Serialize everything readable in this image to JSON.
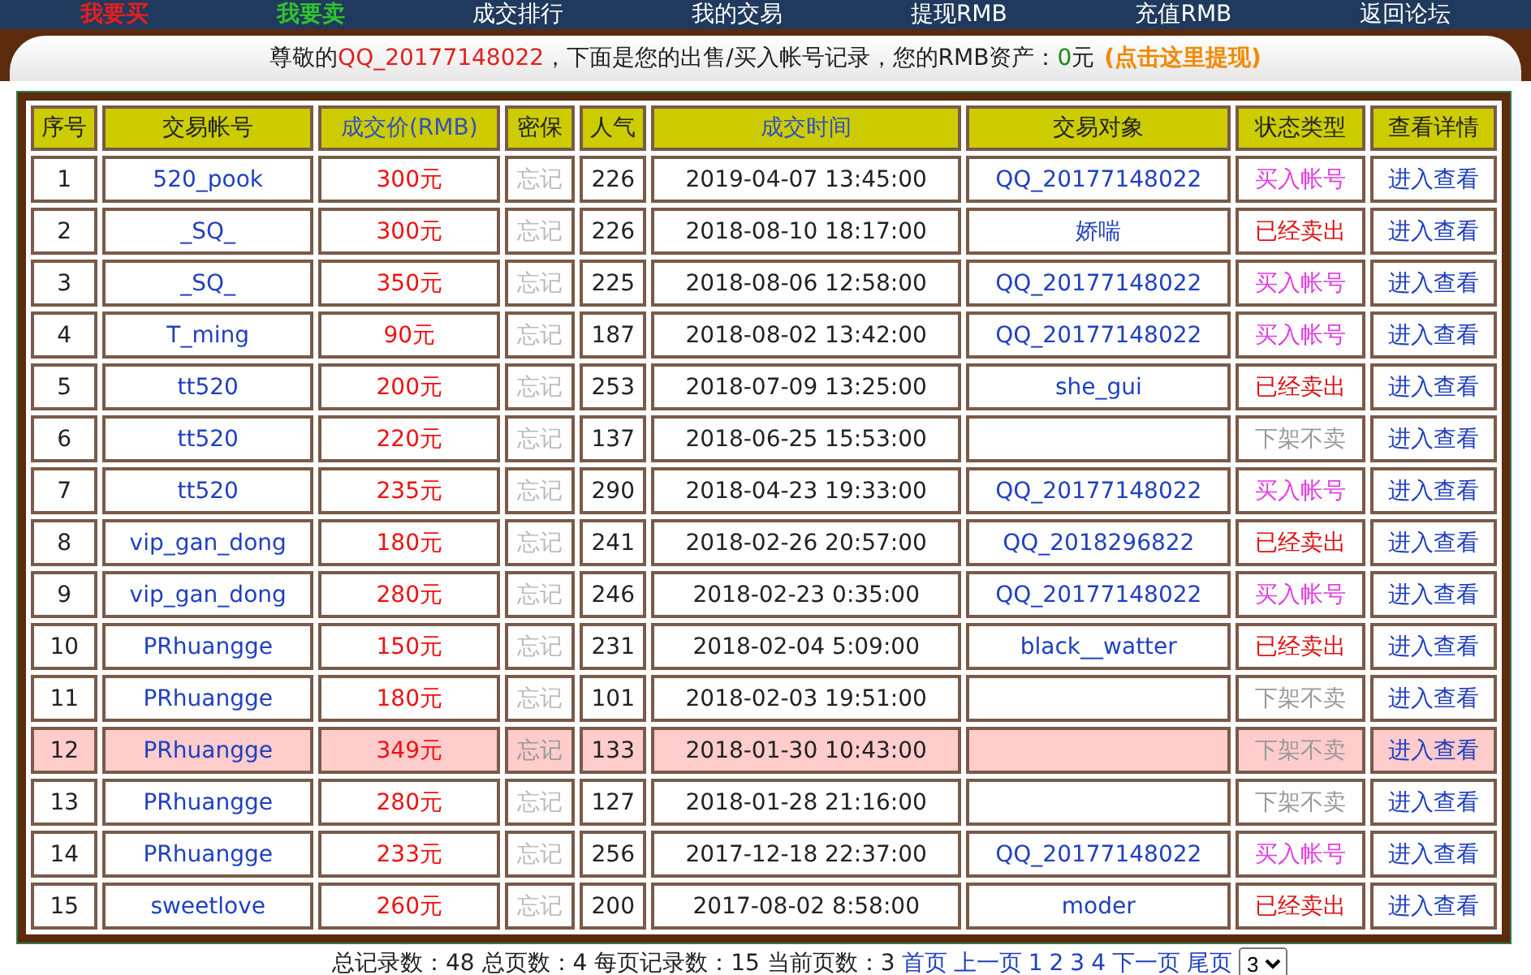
{
  "nav": [
    {
      "label": "我要买",
      "kind": "buy"
    },
    {
      "label": "我要卖",
      "kind": "sell"
    },
    {
      "label": "成交排行",
      "kind": "plain"
    },
    {
      "label": "我的交易",
      "kind": "plain"
    },
    {
      "label": "提现RMB",
      "kind": "plain"
    },
    {
      "label": "充值RMB",
      "kind": "plain"
    },
    {
      "label": "返回论坛",
      "kind": "plain"
    }
  ],
  "notice": {
    "prefix": "尊敬的",
    "user": "QQ_20177148022",
    "middle": "，下面是您的出售/买入帐号记录，您的RMB资产：",
    "amount": "0",
    "unit": "元",
    "link": "(点击这里提现)"
  },
  "table": {
    "columns": [
      "序号",
      "交易帐号",
      "成交价(RMB)",
      "密保",
      "人气",
      "成交时间",
      "交易对象",
      "状态类型",
      "查看详情"
    ],
    "rows": [
      {
        "no": "1",
        "account": "520_pook",
        "price": "300元",
        "security": "忘记",
        "popularity": "226",
        "time": "2019-04-07 13:45:00",
        "party": "QQ_20177148022",
        "status": "买入帐号",
        "kind": "buy",
        "action": "进入查看",
        "selected": false
      },
      {
        "no": "2",
        "account": "_SQ_",
        "price": "300元",
        "security": "忘记",
        "popularity": "226",
        "time": "2018-08-10 18:17:00",
        "party": "娇喘",
        "status": "已经卖出",
        "kind": "sold",
        "action": "进入查看",
        "selected": false
      },
      {
        "no": "3",
        "account": "_SQ_",
        "price": "350元",
        "security": "忘记",
        "popularity": "225",
        "time": "2018-08-06 12:58:00",
        "party": "QQ_20177148022",
        "status": "买入帐号",
        "kind": "buy",
        "action": "进入查看",
        "selected": false
      },
      {
        "no": "4",
        "account": "T_ming",
        "price": "90元",
        "security": "忘记",
        "popularity": "187",
        "time": "2018-08-02 13:42:00",
        "party": "QQ_20177148022",
        "status": "买入帐号",
        "kind": "buy",
        "action": "进入查看",
        "selected": false
      },
      {
        "no": "5",
        "account": "tt520",
        "price": "200元",
        "security": "忘记",
        "popularity": "253",
        "time": "2018-07-09 13:25:00",
        "party": "she_gui",
        "status": "已经卖出",
        "kind": "sold",
        "action": "进入查看",
        "selected": false
      },
      {
        "no": "6",
        "account": "tt520",
        "price": "220元",
        "security": "忘记",
        "popularity": "137",
        "time": "2018-06-25 15:53:00",
        "status": "下架不卖",
        "kind": "delisted",
        "action": "进入查看",
        "selected": false
      },
      {
        "no": "7",
        "account": "tt520",
        "price": "235元",
        "security": "忘记",
        "popularity": "290",
        "time": "2018-04-23 19:33:00",
        "party": "QQ_20177148022",
        "status": "买入帐号",
        "kind": "buy",
        "action": "进入查看",
        "selected": false
      },
      {
        "no": "8",
        "account": "vip_gan_dong",
        "price": "180元",
        "security": "忘记",
        "popularity": "241",
        "time": "2018-02-26 20:57:00",
        "party": "QQ_2018296822",
        "status": "已经卖出",
        "kind": "sold",
        "action": "进入查看",
        "selected": false
      },
      {
        "no": "9",
        "account": "vip_gan_dong",
        "price": "280元",
        "security": "忘记",
        "popularity": "246",
        "time": "2018-02-23 0:35:00",
        "party": "QQ_20177148022",
        "status": "买入帐号",
        "kind": "buy",
        "action": "进入查看",
        "selected": false
      },
      {
        "no": "10",
        "account": "PRhuangge",
        "price": "150元",
        "security": "忘记",
        "popularity": "231",
        "time": "2018-02-04 5:09:00",
        "party": "black__watter",
        "status": "已经卖出",
        "kind": "sold",
        "action": "进入查看",
        "selected": false
      },
      {
        "no": "11",
        "account": "PRhuangge",
        "price": "180元",
        "security": "忘记",
        "popularity": "101",
        "time": "2018-02-03 19:51:00",
        "status": "下架不卖",
        "kind": "delisted",
        "action": "进入查看",
        "selected": false
      },
      {
        "no": "12",
        "account": "PRhuangge",
        "price": "349元",
        "security": "忘记",
        "popularity": "133",
        "time": "2018-01-30 10:43:00",
        "status": "下架不卖",
        "kind": "delisted",
        "action": "进入查看",
        "selected": true
      },
      {
        "no": "13",
        "account": "PRhuangge",
        "price": "280元",
        "security": "忘记",
        "popularity": "127",
        "time": "2018-01-28 21:16:00",
        "status": "下架不卖",
        "kind": "delisted",
        "action": "进入查看",
        "selected": false
      },
      {
        "no": "14",
        "account": "PRhuangge",
        "price": "233元",
        "security": "忘记",
        "popularity": "256",
        "time": "2017-12-18 22:37:00",
        "party": "QQ_20177148022",
        "status": "买入帐号",
        "kind": "buy",
        "action": "进入查看",
        "selected": false
      },
      {
        "no": "15",
        "account": "sweetlove",
        "price": "260元",
        "security": "忘记",
        "popularity": "200",
        "time": "2017-08-02 8:58:00",
        "party": "moder",
        "status": "已经卖出",
        "kind": "sold",
        "action": "进入查看",
        "selected": false
      }
    ]
  },
  "pagination": {
    "summary": "总记录数：48 总页数：4 每页记录数：15 当前页数：3",
    "links": [
      "首页",
      "上一页",
      "1",
      "2",
      "3",
      "4",
      "下一页",
      "尾页"
    ],
    "page_select": "3"
  }
}
